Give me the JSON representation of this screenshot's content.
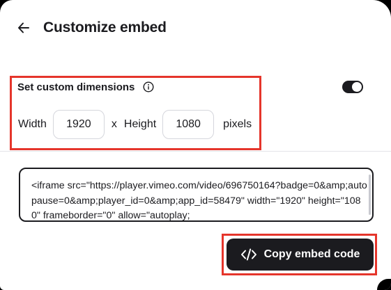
{
  "header": {
    "title": "Customize embed",
    "back_icon": "arrow-left-icon"
  },
  "dimensions": {
    "label": "Set custom dimensions",
    "info_icon": "info-icon",
    "toggle_on": true,
    "width_label": "Width",
    "width_value": "1920",
    "x_label": "x",
    "height_label": "Height",
    "height_value": "1080",
    "unit_label": "pixels"
  },
  "embed": {
    "code": "<iframe src=\"https://player.vimeo.com/video/696750164?badge=0&amp;autopause=0&amp;player_id=0&amp;app_id=58479\" width=\"1920\" height=\"1080\" frameborder=\"0\" allow=\"autoplay;"
  },
  "actions": {
    "copy_label": "Copy embed code",
    "copy_icon": "code-icon"
  },
  "colors": {
    "primary": "#1b1b1f",
    "highlight": "#e5352b"
  }
}
